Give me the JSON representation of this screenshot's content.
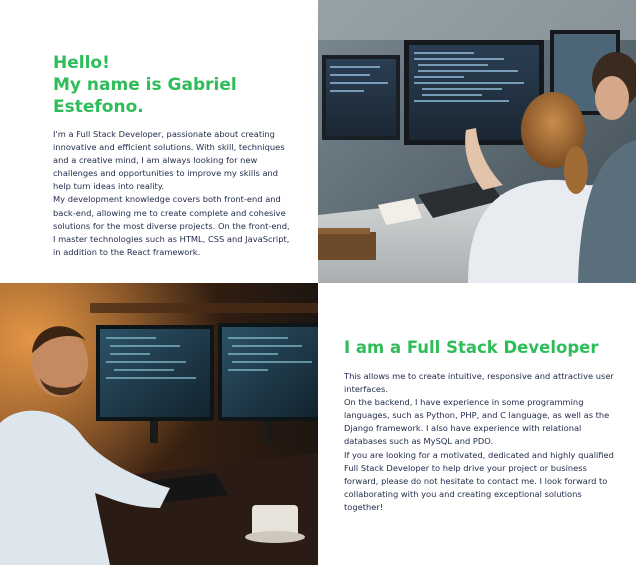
{
  "intro": {
    "greeting": "Hello!",
    "name_line": "My name is Gabriel Estefono.",
    "paragraphs": [
      "I'm a Full Stack Developer, passionate about creating innovative and efficient solutions. With skill, techniques and a creative mind, I am always looking for new challenges and opportunities to improve my skills and help turn ideas into reality.",
      "My development knowledge covers both front-end and back-end, allowing me to create complete and cohesive solutions for the most diverse projects. On the front-end, I master technologies such as HTML, CSS and JavaScript, in addition to the React framework."
    ]
  },
  "skills": {
    "title": "I am a Full Stack Developer",
    "paragraphs": [
      "This allows me to create intuitive, responsive and attractive user interfaces.",
      "On the backend, I have experience in some programming languages, such as Python, PHP, and C language, as well as the Django framework. I also have experience with relational databases such as MySQL and PDO.",
      "If you are looking for a motivated, dedicated and highly qualified Full Stack Developer to help drive your project or business forward, please do not hesitate to contact me. I look forward to collaborating with you and creating exceptional solutions together!"
    ]
  },
  "colors": {
    "accent": "#2ebd59",
    "text": "#1e2a4a",
    "background": "#ffffff"
  }
}
